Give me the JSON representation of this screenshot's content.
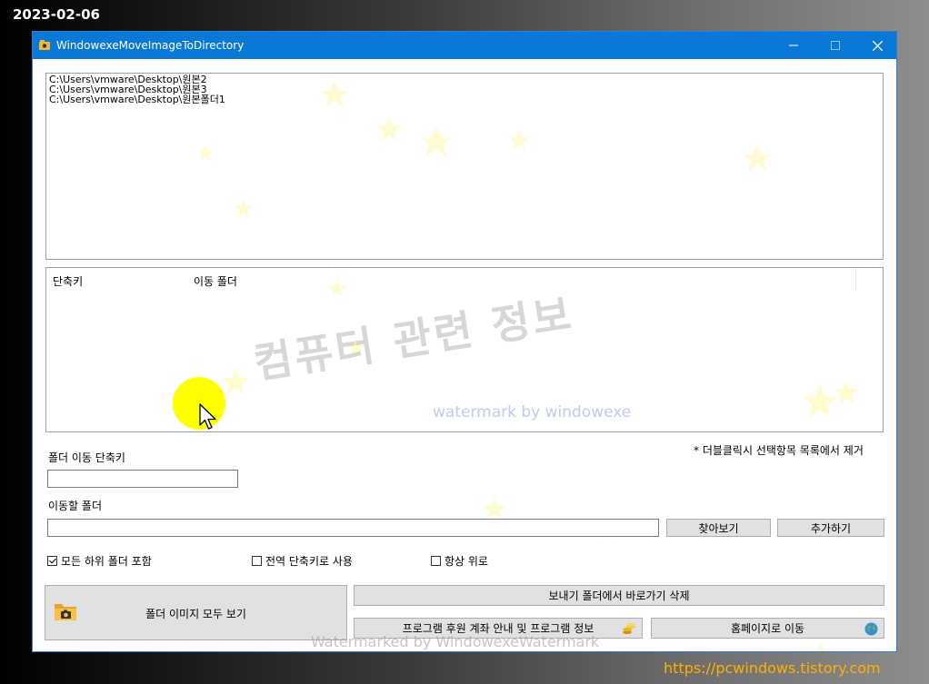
{
  "date_stamp": "2023-02-06",
  "window": {
    "title": "WindowexeMoveImageToDirectory"
  },
  "folder_list": {
    "items": [
      "C:\\Users\\vmware\\Desktop\\원본2",
      "C:\\Users\\vmware\\Desktop\\원본3",
      "C:\\Users\\vmware\\Desktop\\원본폴더1"
    ]
  },
  "shortcut_list": {
    "columns": [
      "단축키",
      "이동 폴더"
    ]
  },
  "watermark": {
    "korean": "컴퓨터 관련 정보",
    "english": "watermark by windowexe",
    "bottom": "Watermarked by WindowexeWatermark"
  },
  "hint": "* 더블클릭시 선택항목 목록에서 제거",
  "hotkey": {
    "label": "폴더 이동 단축키",
    "value": ""
  },
  "target": {
    "label": "이동할 폴더",
    "value": ""
  },
  "buttons": {
    "browse": "찾아보기",
    "add": "추가하기",
    "view_all": "폴더 이미지 모두 보기",
    "delete_shortcut": "보내기 폴더에서 바로가기 삭제",
    "donate_info": "프로그램 후원 계좌 안내 및 프로그램 정보",
    "homepage": "홈페이지로 이동"
  },
  "checkboxes": [
    {
      "label": "모든 하위 폴더 포함",
      "checked": true
    },
    {
      "label": "전역 단축키로 사용",
      "checked": false
    },
    {
      "label": "항상 위로",
      "checked": false
    }
  ],
  "site_url": "https://pcwindows.tistory.com",
  "colors": {
    "titlebar": "#0a78d7",
    "highlight": "#ffff00",
    "url": "#ffb000"
  },
  "icons": [
    "app-icon",
    "minimize-icon",
    "maximize-icon",
    "close-icon",
    "folder-camera-icon",
    "coins-icon",
    "globe-icon",
    "mouse-cursor-icon"
  ]
}
